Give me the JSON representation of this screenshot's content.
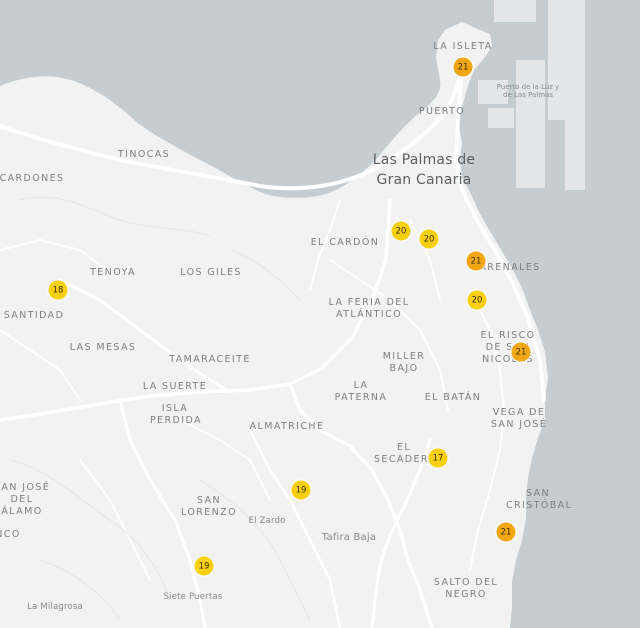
{
  "map": {
    "colors": {
      "water": "#c5cdd1",
      "land": "#f2f2f2",
      "road": "#ffffff",
      "dock": "#e4e6e8",
      "marker_yellow": "#f8d00d",
      "marker_orange": "#f2a614"
    },
    "labels": {
      "la_isleta": "LA ISLETA",
      "puerto": "PUERTO",
      "puerto_de_la_luz": "Puerto de la Luz y de Las Palmas",
      "city": "Las Palmas de Gran Canaria",
      "tinocas": "TINOCAS",
      "cardones": "CARDONES",
      "el_cardon": "EL CARDÓN",
      "tenoya": "TENOYA",
      "los_giles": "LOS GILES",
      "arenales": "ARENALES",
      "santidad": "SANTIDAD",
      "la_feria": "LA FERIA DEL ATLÁNTICO",
      "el_risco": "EL RISCO DE SAN NICOLÁS",
      "las_mesas": "LAS MESAS",
      "tamaraceite": "TAMARACEITE",
      "miller_bajo": "MILLER BAJO",
      "la_suerte": "LA SUERTE",
      "la_paterna": "LA PATERNA",
      "el_batan": "EL BATÁN",
      "isla_perdida": "ISLA PERDIDA",
      "vega_de_san_jose": "VEGA DE SAN JOSÉ",
      "almatriche": "ALMATRICHE",
      "el_secadero": "EL SECADERO",
      "san_jose_del_alamo": "SAN JOSÉ DEL ÁLAMO",
      "san_lorenzo": "SAN LORENZO",
      "san_cristobal": "SAN CRISTÓBAL",
      "el_zardo": "El Zardo",
      "tafira_baja": "Tafira Baja",
      "nco": "NCO",
      "salto_del_negro": "SALTO DEL NEGRO",
      "la_milagrosa": "La Milagrosa",
      "siete_puertas": "Siete Puertas"
    },
    "markers": [
      {
        "label": "21",
        "color": "orange"
      },
      {
        "label": "20",
        "color": "yellow"
      },
      {
        "label": "20",
        "color": "yellow"
      },
      {
        "label": "21",
        "color": "orange"
      },
      {
        "label": "18",
        "color": "yellow"
      },
      {
        "label": "20",
        "color": "yellow"
      },
      {
        "label": "21",
        "color": "orange"
      },
      {
        "label": "17",
        "color": "yellow"
      },
      {
        "label": "19",
        "color": "yellow"
      },
      {
        "label": "21",
        "color": "orange"
      },
      {
        "label": "19",
        "color": "yellow"
      }
    ]
  }
}
